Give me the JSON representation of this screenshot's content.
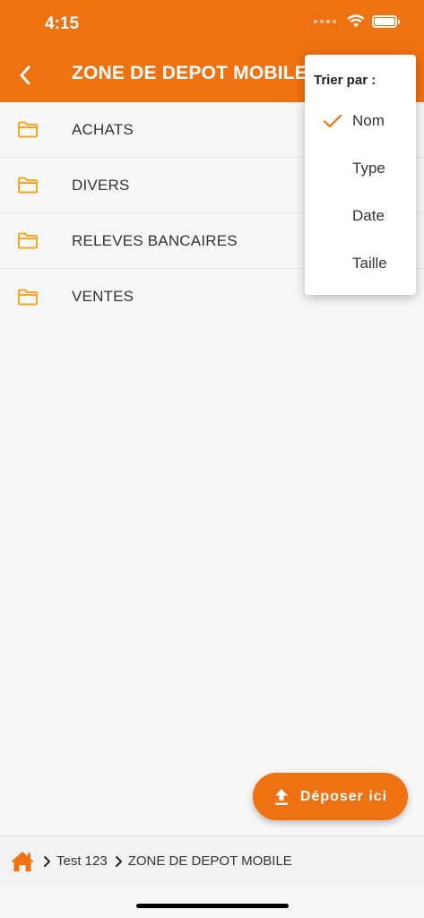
{
  "status_bar": {
    "time": "4:15"
  },
  "header": {
    "title": "ZONE DE DEPOT MOBILE"
  },
  "folders": [
    {
      "label": "ACHATS"
    },
    {
      "label": "DIVERS"
    },
    {
      "label": "RELEVES BANCAIRES"
    },
    {
      "label": "VENTES"
    }
  ],
  "sort_menu": {
    "title": "Trier par :",
    "selected": "Nom",
    "items": [
      {
        "label": "Nom"
      },
      {
        "label": "Type"
      },
      {
        "label": "Date"
      },
      {
        "label": "Taille"
      }
    ]
  },
  "upload_button": {
    "label": "Déposer ici"
  },
  "breadcrumb": {
    "items": [
      {
        "label": "Test 123"
      },
      {
        "label": "ZONE DE DEPOT MOBILE"
      }
    ]
  },
  "colors": {
    "accent": "#ee7211",
    "folder": "#f6a623",
    "background": "#f7f7f7"
  },
  "icons": {
    "home": "home-icon",
    "folder": "folder-icon",
    "back": "chevron-left-icon",
    "check": "check-icon",
    "upload": "upload-icon"
  }
}
